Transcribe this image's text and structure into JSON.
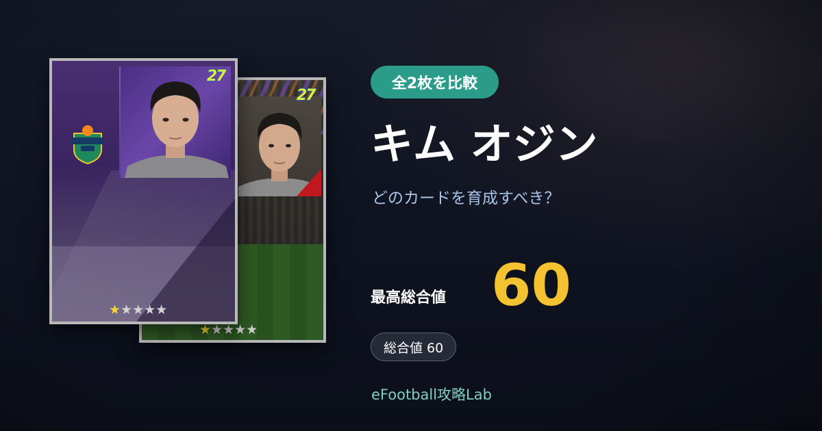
{
  "page": {
    "compare_badge": "全2枚を比較",
    "player_name": "キム オジン",
    "subtitle": "どのカードを育成すべき？",
    "max_overall_label": "最高総合値",
    "max_overall_value": "60",
    "overall_chip": "総合値 60",
    "brand": "eFootball攻略Lab"
  },
  "cards": [
    {
      "season_logo": "27",
      "club": "GANGWON FC",
      "stars_total": 5,
      "stars_filled": 1
    },
    {
      "season_logo": "27",
      "stars_total": 5,
      "stars_filled": 1
    }
  ],
  "colors": {
    "accent_teal": "#2a9c89",
    "value_gold": "#f2c230",
    "subtitle_blue": "#a9c4e8",
    "brand_teal": "#7fd0c2"
  }
}
